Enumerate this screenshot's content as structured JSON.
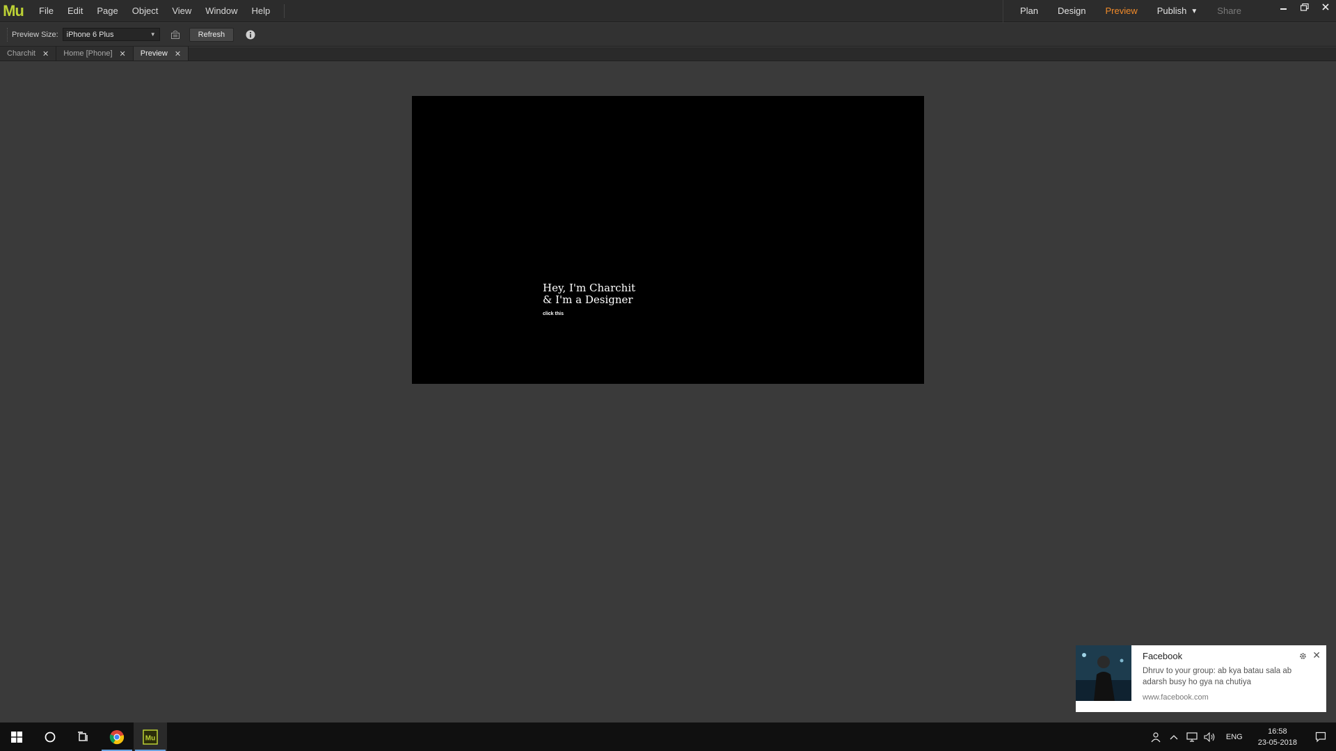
{
  "app": {
    "logo": "Mu"
  },
  "menu": [
    "File",
    "Edit",
    "Page",
    "Object",
    "View",
    "Window",
    "Help"
  ],
  "modes": {
    "plan": "Plan",
    "design": "Design",
    "preview": "Preview",
    "publish": "Publish",
    "share": "Share"
  },
  "colors": {
    "accent_active": "#f28b2a",
    "muse_logo": "#bcd135"
  },
  "toolbar": {
    "preview_size_label": "Preview Size:",
    "preview_size_value": "iPhone 6 Plus",
    "refresh_label": "Refresh"
  },
  "tabs": [
    {
      "label": "Charchit",
      "active": false
    },
    {
      "label": "Home [Phone]",
      "active": false
    },
    {
      "label": "Preview",
      "active": true
    }
  ],
  "preview": {
    "line1": "Hey, I'm Charchit",
    "line2": "& I'm a Designer",
    "link": "click this"
  },
  "notification": {
    "title": "Facebook",
    "message": "Dhruv to your group: ab kya batau sala ab adarsh busy ho gya na chutiya",
    "source": "www.facebook.com"
  },
  "taskbar": {
    "apps": [
      "windows-start",
      "cortana",
      "task-view",
      "chrome",
      "adobe-muse"
    ],
    "lang": "ENG",
    "time": "16:58",
    "date": "23-05-2018"
  }
}
